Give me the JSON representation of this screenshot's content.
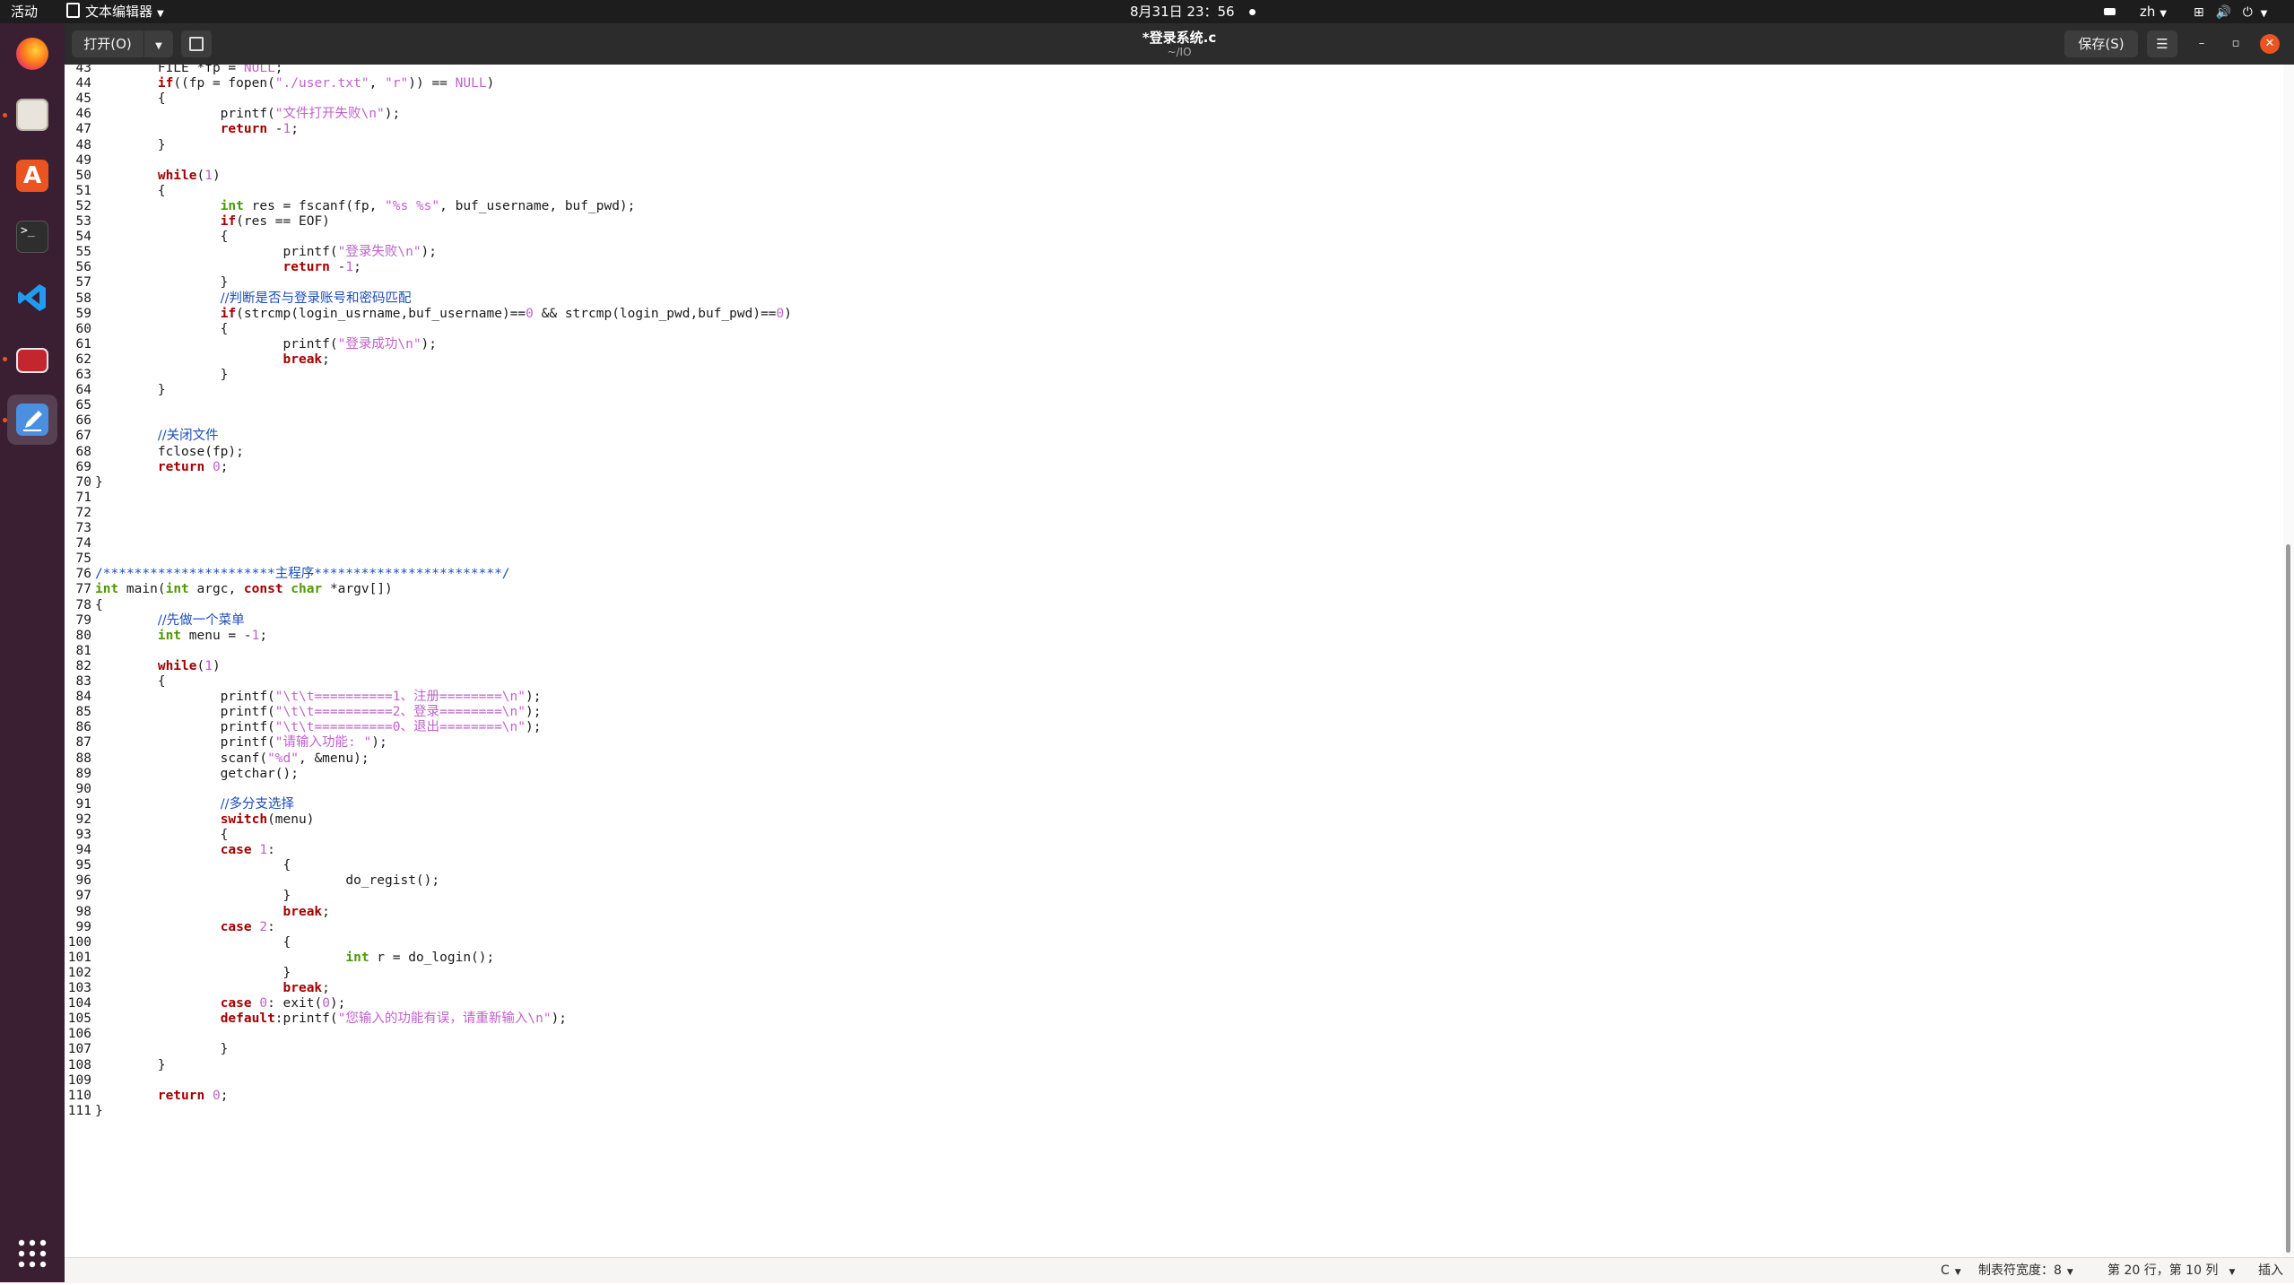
{
  "topbar": {
    "activities": "活动",
    "app_menu": "文本编辑器",
    "clock": "8月31日 23：56",
    "input_method": "zh"
  },
  "window": {
    "title": "*登录系统.c",
    "subtitle": "~/IO",
    "open_label": "打开(O)",
    "save_label": "保存(S)"
  },
  "status": {
    "language": "C",
    "tab_width": "制表符宽度：8",
    "position": "第 20 行，第 10 列",
    "mode": "插入"
  },
  "colors": {
    "keyword": "#a40000",
    "type": "#4e9a06",
    "string": "#c061cb",
    "comment": "#1c4cbb"
  },
  "code_lines": [
    {
      "n": "43",
      "t": "\tFILE *fp = NULL;"
    },
    {
      "n": "44",
      "t": "\tif((fp = fopen(\"./user.txt\", \"r\")) == NULL)"
    },
    {
      "n": "45",
      "t": "\t{"
    },
    {
      "n": "46",
      "t": "\t\tprintf(\"文件打开失败\\n\");"
    },
    {
      "n": "47",
      "t": "\t\treturn -1;"
    },
    {
      "n": "48",
      "t": "\t}"
    },
    {
      "n": "49",
      "t": ""
    },
    {
      "n": "50",
      "t": "\twhile(1)"
    },
    {
      "n": "51",
      "t": "\t{"
    },
    {
      "n": "52",
      "t": "\t\tint res = fscanf(fp, \"%s %s\", buf_username, buf_pwd);"
    },
    {
      "n": "53",
      "t": "\t\tif(res == EOF)"
    },
    {
      "n": "54",
      "t": "\t\t{"
    },
    {
      "n": "55",
      "t": "\t\t\tprintf(\"登录失败\\n\");"
    },
    {
      "n": "56",
      "t": "\t\t\treturn -1;"
    },
    {
      "n": "57",
      "t": "\t\t}"
    },
    {
      "n": "58",
      "t": "\t\t//判断是否与登录账号和密码匹配"
    },
    {
      "n": "59",
      "t": "\t\tif(strcmp(login_usrname,buf_username)==0 && strcmp(login_pwd,buf_pwd)==0)"
    },
    {
      "n": "60",
      "t": "\t\t{"
    },
    {
      "n": "61",
      "t": "\t\t\tprintf(\"登录成功\\n\");"
    },
    {
      "n": "62",
      "t": "\t\t\tbreak;"
    },
    {
      "n": "63",
      "t": "\t\t}"
    },
    {
      "n": "64",
      "t": "\t}"
    },
    {
      "n": "65",
      "t": ""
    },
    {
      "n": "66",
      "t": ""
    },
    {
      "n": "67",
      "t": "\t//关闭文件"
    },
    {
      "n": "68",
      "t": "\tfclose(fp);"
    },
    {
      "n": "69",
      "t": "\treturn 0;"
    },
    {
      "n": "70",
      "t": "}"
    },
    {
      "n": "71",
      "t": ""
    },
    {
      "n": "72",
      "t": ""
    },
    {
      "n": "73",
      "t": ""
    },
    {
      "n": "74",
      "t": ""
    },
    {
      "n": "75",
      "t": ""
    },
    {
      "n": "76",
      "t": "/**********************主程序************************/"
    },
    {
      "n": "77",
      "t": "int main(int argc, const char *argv[])"
    },
    {
      "n": "78",
      "t": "{"
    },
    {
      "n": "79",
      "t": "\t//先做一个菜单"
    },
    {
      "n": "80",
      "t": "\tint menu = -1;"
    },
    {
      "n": "81",
      "t": ""
    },
    {
      "n": "82",
      "t": "\twhile(1)"
    },
    {
      "n": "83",
      "t": "\t{"
    },
    {
      "n": "84",
      "t": "\t\tprintf(\"\\t\\t==========1、注册========\\n\");"
    },
    {
      "n": "85",
      "t": "\t\tprintf(\"\\t\\t==========2、登录========\\n\");"
    },
    {
      "n": "86",
      "t": "\t\tprintf(\"\\t\\t==========0、退出========\\n\");"
    },
    {
      "n": "87",
      "t": "\t\tprintf(\"请输入功能: \");"
    },
    {
      "n": "88",
      "t": "\t\tscanf(\"%d\", &menu);"
    },
    {
      "n": "89",
      "t": "\t\tgetchar();"
    },
    {
      "n": "90",
      "t": ""
    },
    {
      "n": "91",
      "t": "\t\t//多分支选择"
    },
    {
      "n": "92",
      "t": "\t\tswitch(menu)"
    },
    {
      "n": "93",
      "t": "\t\t{"
    },
    {
      "n": "94",
      "t": "\t\tcase 1:"
    },
    {
      "n": "95",
      "t": "\t\t\t{"
    },
    {
      "n": "96",
      "t": "\t\t\t\tdo_regist();"
    },
    {
      "n": "97",
      "t": "\t\t\t}"
    },
    {
      "n": "98",
      "t": "\t\t\tbreak;"
    },
    {
      "n": "99",
      "t": "\t\tcase 2:"
    },
    {
      "n": "100",
      "t": "\t\t\t{"
    },
    {
      "n": "101",
      "t": "\t\t\t\tint r = do_login();"
    },
    {
      "n": "102",
      "t": "\t\t\t}"
    },
    {
      "n": "103",
      "t": "\t\t\tbreak;"
    },
    {
      "n": "104",
      "t": "\t\tcase 0: exit(0);"
    },
    {
      "n": "105",
      "t": "\t\tdefault:printf(\"您输入的功能有误，请重新输入\\n\");"
    },
    {
      "n": "106",
      "t": ""
    },
    {
      "n": "107",
      "t": "\t\t}"
    },
    {
      "n": "108",
      "t": "\t}"
    },
    {
      "n": "109",
      "t": ""
    },
    {
      "n": "110",
      "t": "\treturn 0;"
    },
    {
      "n": "111",
      "t": "}"
    }
  ]
}
